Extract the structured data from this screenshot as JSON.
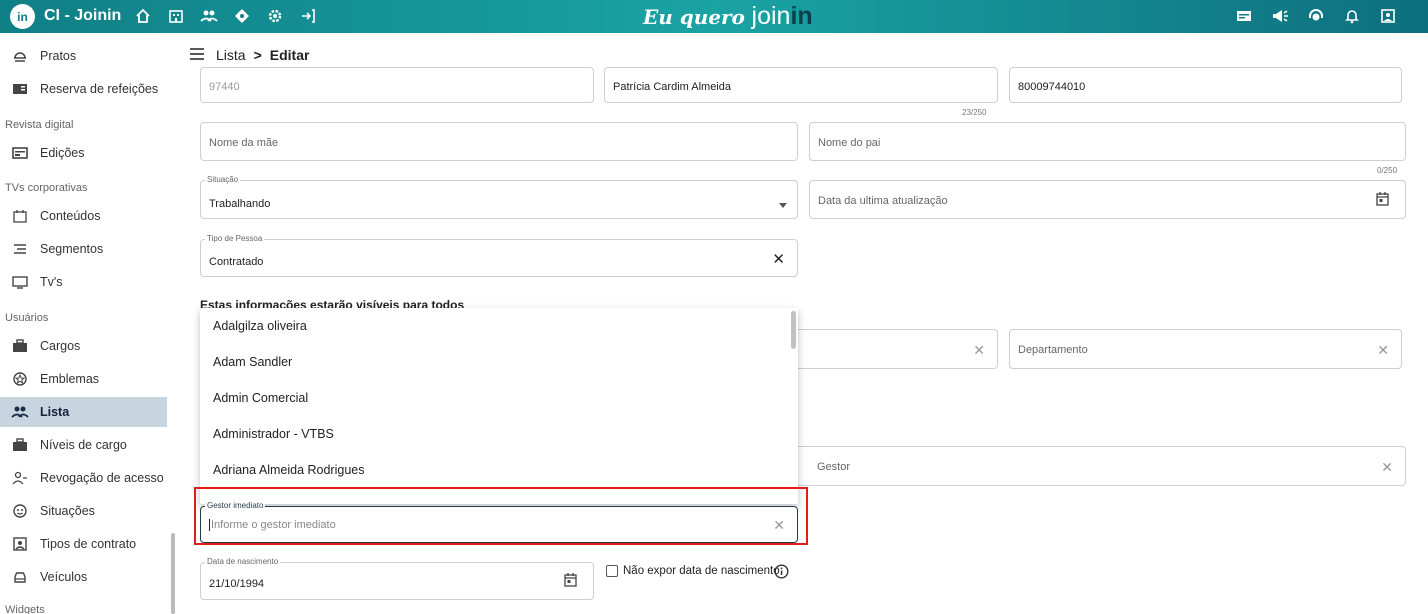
{
  "topbar": {
    "logo_text": "in",
    "app_name": "CI - Joinin",
    "brand_slogan": "Eu quero",
    "brand_word_a": "join",
    "brand_word_b": "in",
    "nav_icons": [
      "home-icon",
      "building-icon",
      "users-icon",
      "tag-icon",
      "gear-icon",
      "logout-icon"
    ],
    "right_icons": [
      "chat-icon",
      "megaphone-icon",
      "support-icon",
      "bell-icon",
      "account-icon"
    ]
  },
  "sidebar": {
    "items": [
      {
        "label": "Pratos",
        "icon": "dish-icon"
      },
      {
        "label": "Reserva de refeições",
        "icon": "book-icon"
      },
      {
        "label": "Edições",
        "icon": "newspaper-icon"
      },
      {
        "label": "Conteúdos",
        "icon": "calendar-icon"
      },
      {
        "label": "Segmentos",
        "icon": "list-icon"
      },
      {
        "label": "Tv's",
        "icon": "tv-icon"
      },
      {
        "label": "Cargos",
        "icon": "briefcase-icon"
      },
      {
        "label": "Emblemas",
        "icon": "badge-icon"
      },
      {
        "label": "Lista",
        "icon": "people-icon"
      },
      {
        "label": "Níveis de cargo",
        "icon": "briefcase-icon"
      },
      {
        "label": "Revogação de acesso",
        "icon": "person-remove-icon"
      },
      {
        "label": "Situações",
        "icon": "face-icon"
      },
      {
        "label": "Tipos de contrato",
        "icon": "contract-icon"
      },
      {
        "label": "Veículos",
        "icon": "car-icon"
      }
    ],
    "sections": [
      "Revista digital",
      "TVs corporativas",
      "Usuários",
      "Widgets"
    ]
  },
  "header": {
    "parent": "Lista",
    "separator": ">",
    "current": "Editar"
  },
  "form": {
    "code_value": "97440",
    "name_value": "Patrícia Cardim Almeida",
    "name_counter": "23/250",
    "doc_value": "80009744010",
    "mother_placeholder": "Nome da mãe",
    "father_placeholder": "Nome do pai",
    "father_counter": "0/250",
    "situacao_label": "Situação",
    "situacao_value": "Trabalhando",
    "update_placeholder": "Data da ultima atualização",
    "tipo_label": "Tipo de Pessoa",
    "tipo_value": "Contratado",
    "visible_title": "Estas informações estarão visíveis para todos",
    "departamento_placeholder": "Departamento",
    "gestor_placeholder": "Gestor",
    "gestor_imediato_label": "Gestor imediato",
    "gestor_imediato_placeholder": "Informe o gestor imediato",
    "nascimento_label": "Data de nascimento",
    "nascimento_value": "21/10/1994",
    "hide_birth_label": "Não expor data de nascimento"
  },
  "dropdown": {
    "options": [
      "Adalgilza oliveira",
      "Adam Sandler",
      "Admin Comercial",
      "Administrador - VTBS",
      "Adriana Almeida Rodrigues"
    ]
  },
  "colors": {
    "brand": "#1aa3a3",
    "active_item": "#c7d5e0",
    "highlight": "#e21b1b",
    "focus_border": "#1f3b4d"
  }
}
